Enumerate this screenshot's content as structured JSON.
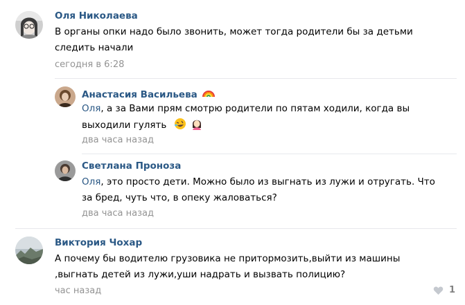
{
  "comments": [
    {
      "author": "Оля Николаева",
      "text_lines": [
        "В органы опки надо было звонить, может тогда родители бы за детьми",
        "следить начали"
      ],
      "date": "сегодня в 6:28"
    },
    {
      "author": "Анастасия Васильева",
      "mention": "Оля",
      "text_lines": [
        ", а за Вами прям смотрю родители по пятам ходили, когда вы",
        "выходили гулять"
      ],
      "date": "два часа назад"
    },
    {
      "author": "Светлана Проноза",
      "mention": "Оля",
      "text_lines": [
        ", это просто дети. Можно было из выгнать из лужи и отругать. Что",
        "за бред, чуть что, в опеку жаловаться?"
      ],
      "date": "два часа назад"
    },
    {
      "author": "Виктория Чохар",
      "text_lines": [
        "А почему бы водителю грузовика не притормозить,выйти из машины",
        ",выгнать детей из лужи,уши надрать и вызвать полицию?"
      ],
      "date": "час назад",
      "likes": "1"
    }
  ],
  "icons": {
    "rainbow": "rainbow-emoji-icon",
    "laughing": "rofl-emoji-icon",
    "woman": "woman-emoji-icon",
    "heart": "heart-icon"
  },
  "colors": {
    "author": "#2a5885",
    "meta": "#939393",
    "divider": "#e7e8ec"
  }
}
